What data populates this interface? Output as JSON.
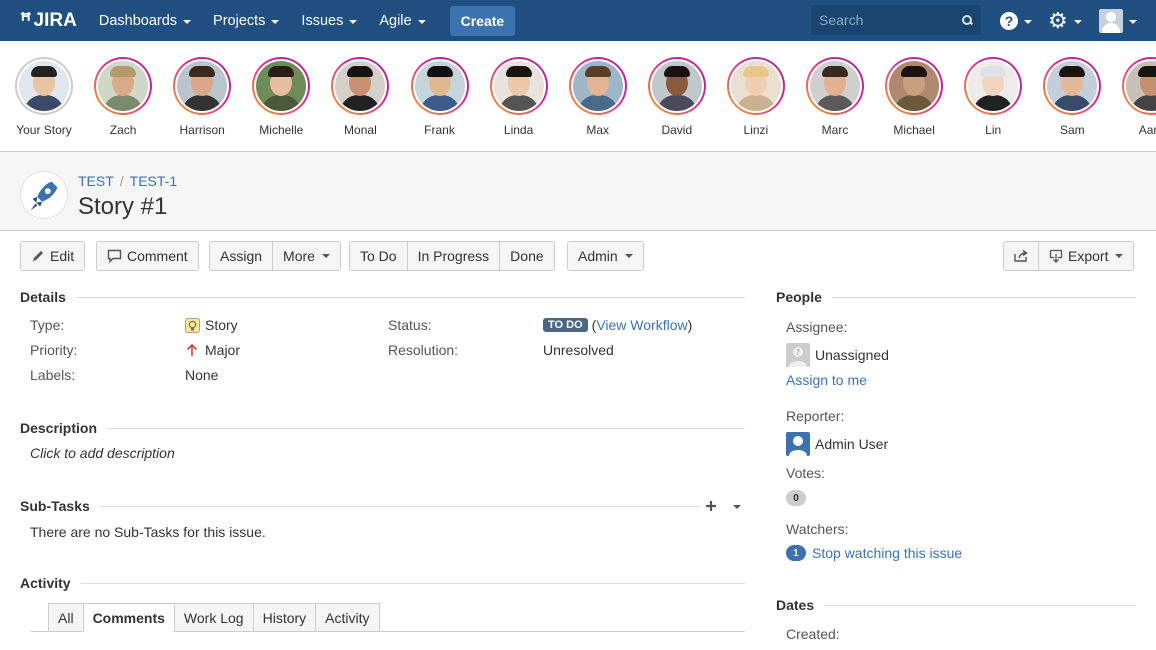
{
  "nav": {
    "logo": "JIRA",
    "items": [
      "Dashboards",
      "Projects",
      "Issues",
      "Agile"
    ],
    "create_label": "Create",
    "search_placeholder": "Search",
    "help_glyph": "?",
    "brand_color": "#205081"
  },
  "stories": [
    {
      "name": "Your Story",
      "skin": "#e8c4a0",
      "hair": "#222",
      "shirt": "#3b4a6b",
      "bg": "#dfe6ee",
      "self": true
    },
    {
      "name": "Zach",
      "skin": "#d9a98a",
      "hair": "#b39a6b",
      "shirt": "#7a8a6a",
      "bg": "#cfd8c8"
    },
    {
      "name": "Harrison",
      "skin": "#d8a888",
      "hair": "#3a2a1e",
      "shirt": "#333",
      "bg": "#b9c4cc"
    },
    {
      "name": "Michelle",
      "skin": "#e6bda0",
      "hair": "#2a1e18",
      "shirt": "#4a5a3a",
      "bg": "#6f8b5a"
    },
    {
      "name": "Monal",
      "skin": "#c89070",
      "hair": "#1a1210",
      "shirt": "#222",
      "bg": "#d4cfc8"
    },
    {
      "name": "Frank",
      "skin": "#e0b890",
      "hair": "#111",
      "shirt": "#3d5a8a",
      "bg": "#c8d4dc"
    },
    {
      "name": "Linda",
      "skin": "#ecc7a8",
      "hair": "#1a1410",
      "shirt": "#555",
      "bg": "#e8e2dc"
    },
    {
      "name": "Max",
      "skin": "#e2b494",
      "hair": "#5a3e28",
      "shirt": "#4a6a8a",
      "bg": "#9fb6c8"
    },
    {
      "name": "David",
      "skin": "#8a5a3e",
      "hair": "#1a1210",
      "shirt": "#4a4a5a",
      "bg": "#c0c8cc"
    },
    {
      "name": "Linzi",
      "skin": "#f0cdb0",
      "hair": "#e8c88a",
      "shirt": "#c8b090",
      "bg": "#e8e0d0"
    },
    {
      "name": "Marc",
      "skin": "#e0b090",
      "hair": "#3a2a1e",
      "shirt": "#5a5a5a",
      "bg": "#cfcfcf"
    },
    {
      "name": "Michael",
      "skin": "#c8a080",
      "hair": "#1a1410",
      "shirt": "#6a5a3a",
      "bg": "#b08870"
    },
    {
      "name": "Lin",
      "skin": "#f0d4c0",
      "hair": "#e0e0e8",
      "shirt": "#222",
      "bg": "#ecebe8"
    },
    {
      "name": "Sam",
      "skin": "#e2b898",
      "hair": "#1a1410",
      "shirt": "#3a4a6a",
      "bg": "#c4ced8"
    },
    {
      "name": "Aaro",
      "skin": "#c49070",
      "hair": "#1a1410",
      "shirt": "#444",
      "bg": "#c8c0b8"
    }
  ],
  "issue": {
    "project": "TEST",
    "key": "TEST-1",
    "title": "Story #1"
  },
  "toolbar": {
    "edit": "Edit",
    "comment": "Comment",
    "assign": "Assign",
    "more": "More",
    "todo": "To Do",
    "in_progress": "In Progress",
    "done": "Done",
    "admin": "Admin",
    "export": "Export"
  },
  "details": {
    "heading": "Details",
    "type_label": "Type:",
    "type_value": "Story",
    "priority_label": "Priority:",
    "priority_value": "Major",
    "labels_label": "Labels:",
    "labels_value": "None",
    "status_label": "Status:",
    "status_lozenge": "TO DO",
    "status_open_paren": "(",
    "status_link": "View Workflow",
    "status_close_paren": ")",
    "resolution_label": "Resolution:",
    "resolution_value": "Unresolved"
  },
  "description": {
    "heading": "Description",
    "placeholder": "Click to add description"
  },
  "subtasks": {
    "heading": "Sub-Tasks",
    "empty": "There are no Sub-Tasks for this issue."
  },
  "activity": {
    "heading": "Activity",
    "tabs": [
      "All",
      "Comments",
      "Work Log",
      "History",
      "Activity"
    ],
    "active_tab": "Comments"
  },
  "people": {
    "heading": "People",
    "assignee_label": "Assignee:",
    "assignee_value": "Unassigned",
    "assign_to_me": "Assign to me",
    "reporter_label": "Reporter:",
    "reporter_value": "Admin User",
    "votes_label": "Votes:",
    "votes_count": "0",
    "watchers_label": "Watchers:",
    "watchers_count": "1",
    "watch_link": "Stop watching this issue"
  },
  "dates": {
    "heading": "Dates",
    "created_label": "Created:"
  }
}
